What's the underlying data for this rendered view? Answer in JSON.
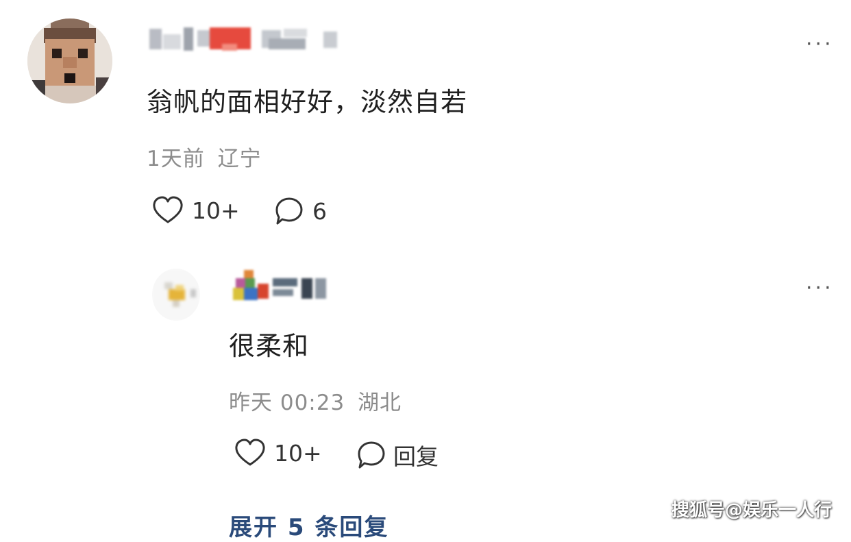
{
  "comment": {
    "text": "翁帆的面相好好，淡然自若",
    "time": "1天前",
    "location": "辽宁",
    "likes": "10+",
    "replies_count": "6",
    "more_icon": "ellipsis-icon"
  },
  "reply": {
    "text": "很柔和",
    "time": "昨天 00:23",
    "location": "湖北",
    "likes": "10+",
    "reply_label": "回复",
    "more_icon": "ellipsis-icon"
  },
  "expand_replies": "展开 5 条回复",
  "watermark": "搜狐号@娱乐一人行",
  "colors": {
    "text_main": "#1f1f1f",
    "text_meta": "#8c8c8c",
    "link": "#2a4a7a",
    "background": "#ffffff"
  }
}
